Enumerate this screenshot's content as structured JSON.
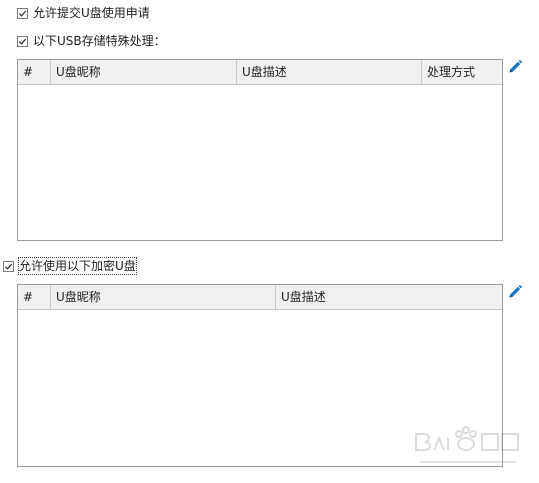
{
  "options": {
    "allow_request_label": "允许提交U盘使用申请",
    "special_usb_label": "以下USB存储特殊处理：",
    "allow_encrypted_label": "允许使用以下加密U盘"
  },
  "usb_table": {
    "columns": [
      "#",
      "U盘昵称",
      "U盘描述",
      "处理方式"
    ],
    "rows": []
  },
  "encrypted_table": {
    "columns": [
      "#",
      "U盘昵称",
      "U盘描述"
    ],
    "rows": []
  },
  "icons": {
    "checkbox_check": "check-icon",
    "edit": "pencil-icon",
    "edit_color": "#1a73c8"
  }
}
